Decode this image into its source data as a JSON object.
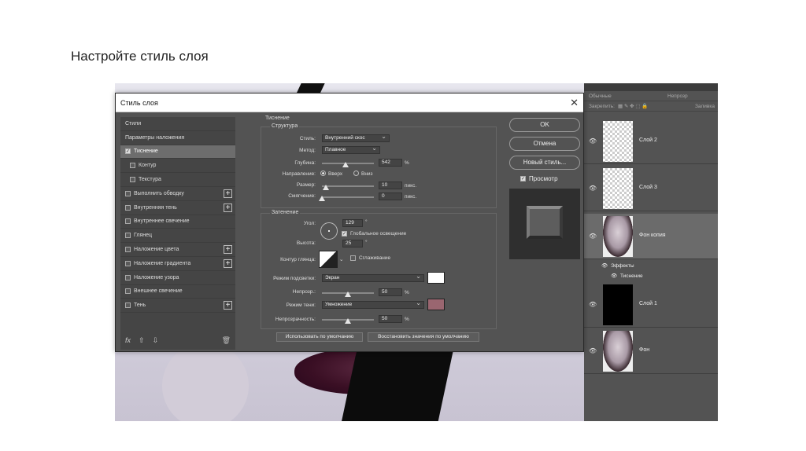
{
  "slide": {
    "title": "Настройте стиль слоя"
  },
  "dialog": {
    "title": "Стиль слоя",
    "close": "✕",
    "styles_list": [
      {
        "label": "Стили",
        "checkbox": false,
        "plus": false,
        "indent": false
      },
      {
        "label": "Параметры наложения",
        "checkbox": false,
        "plus": false,
        "indent": false
      },
      {
        "label": "Тиснение",
        "checkbox": true,
        "checked": true,
        "plus": false,
        "indent": false,
        "selected": true
      },
      {
        "label": "Контур",
        "checkbox": true,
        "checked": false,
        "plus": false,
        "indent": true
      },
      {
        "label": "Текстура",
        "checkbox": true,
        "checked": false,
        "plus": false,
        "indent": true
      },
      {
        "label": "Выполнить обводку",
        "checkbox": true,
        "checked": false,
        "plus": true,
        "indent": false
      },
      {
        "label": "Внутренняя тень",
        "checkbox": true,
        "checked": false,
        "plus": true,
        "indent": false
      },
      {
        "label": "Внутреннее свечение",
        "checkbox": true,
        "checked": false,
        "plus": false,
        "indent": false
      },
      {
        "label": "Глянец",
        "checkbox": true,
        "checked": false,
        "plus": false,
        "indent": false
      },
      {
        "label": "Наложение цвета",
        "checkbox": true,
        "checked": false,
        "plus": true,
        "indent": false
      },
      {
        "label": "Наложение градиента",
        "checkbox": true,
        "checked": false,
        "plus": true,
        "indent": false
      },
      {
        "label": "Наложение узора",
        "checkbox": true,
        "checked": false,
        "plus": false,
        "indent": false
      },
      {
        "label": "Внешнее свечение",
        "checkbox": true,
        "checked": false,
        "plus": false,
        "indent": false
      },
      {
        "label": "Тень",
        "checkbox": true,
        "checked": false,
        "plus": true,
        "indent": false
      }
    ],
    "list_footer": {
      "fx": "fx",
      "up": "⇧",
      "down": "⇩",
      "trash": "🗑"
    },
    "bevel": {
      "section": "Тиснение",
      "structure_title": "Структура",
      "style_label": "Стиль:",
      "style_value": "Внутренний скос",
      "method_label": "Метод:",
      "method_value": "Плавное",
      "depth_label": "Глубина:",
      "depth_value": "542",
      "depth_unit": "%",
      "depth_level": 0.45,
      "direction_label": "Направление:",
      "dir_up": "Вверх",
      "dir_down": "Вниз",
      "size_label": "Размер:",
      "size_value": "10",
      "size_unit": "пикс.",
      "size_level": 0.08,
      "soften_label": "Смягчение:",
      "soften_value": "0",
      "soften_unit": "пикс.",
      "soften_level": 0.0
    },
    "shading": {
      "title": "Затенение",
      "angle_label": "Угол:",
      "angle_value": "129",
      "angle_unit": "°",
      "global_light": "Глобальное освещение",
      "altitude_label": "Высота:",
      "altitude_value": "25",
      "altitude_unit": "°",
      "gloss_label": "Контур глянца:",
      "antialias": "Сглаживание",
      "highlight_label": "Режим подсветки:",
      "highlight_value": "Экран",
      "highlight_color": "#ffffff",
      "highlight_opacity_label": "Непрозр.:",
      "highlight_opacity": "50",
      "highlight_opacity_unit": "%",
      "shadow_label": "Режим тени:",
      "shadow_value": "Умножение",
      "shadow_color": "#9a6670",
      "shadow_opacity_label": "Непрозрачность:",
      "shadow_opacity": "50",
      "shadow_opacity_unit": "%"
    },
    "defaults": {
      "make": "Использовать по умолчанию",
      "reset": "Восстановить значения по умолчанию"
    },
    "buttons": {
      "ok": "OK",
      "cancel": "Отмена",
      "new_style": "Новый стиль...",
      "preview": "Просмотр"
    }
  },
  "layers": {
    "blend_mode": "Обычные",
    "opacity_label": "Непрозр",
    "lock_label": "Закрепить:",
    "fill_label": "Заливка",
    "items": [
      {
        "name": "Слой 2",
        "thumb": "checker"
      },
      {
        "name": "Слой 3",
        "thumb": "checker"
      },
      {
        "name": "Фон копия",
        "thumb": "face",
        "selected": true
      },
      {
        "name": "Слой 1",
        "thumb": "black"
      },
      {
        "name": "Фон",
        "thumb": "face"
      }
    ],
    "effects_label": "Эффекты",
    "effect_item": "Тиснение",
    "eye": "👁"
  }
}
